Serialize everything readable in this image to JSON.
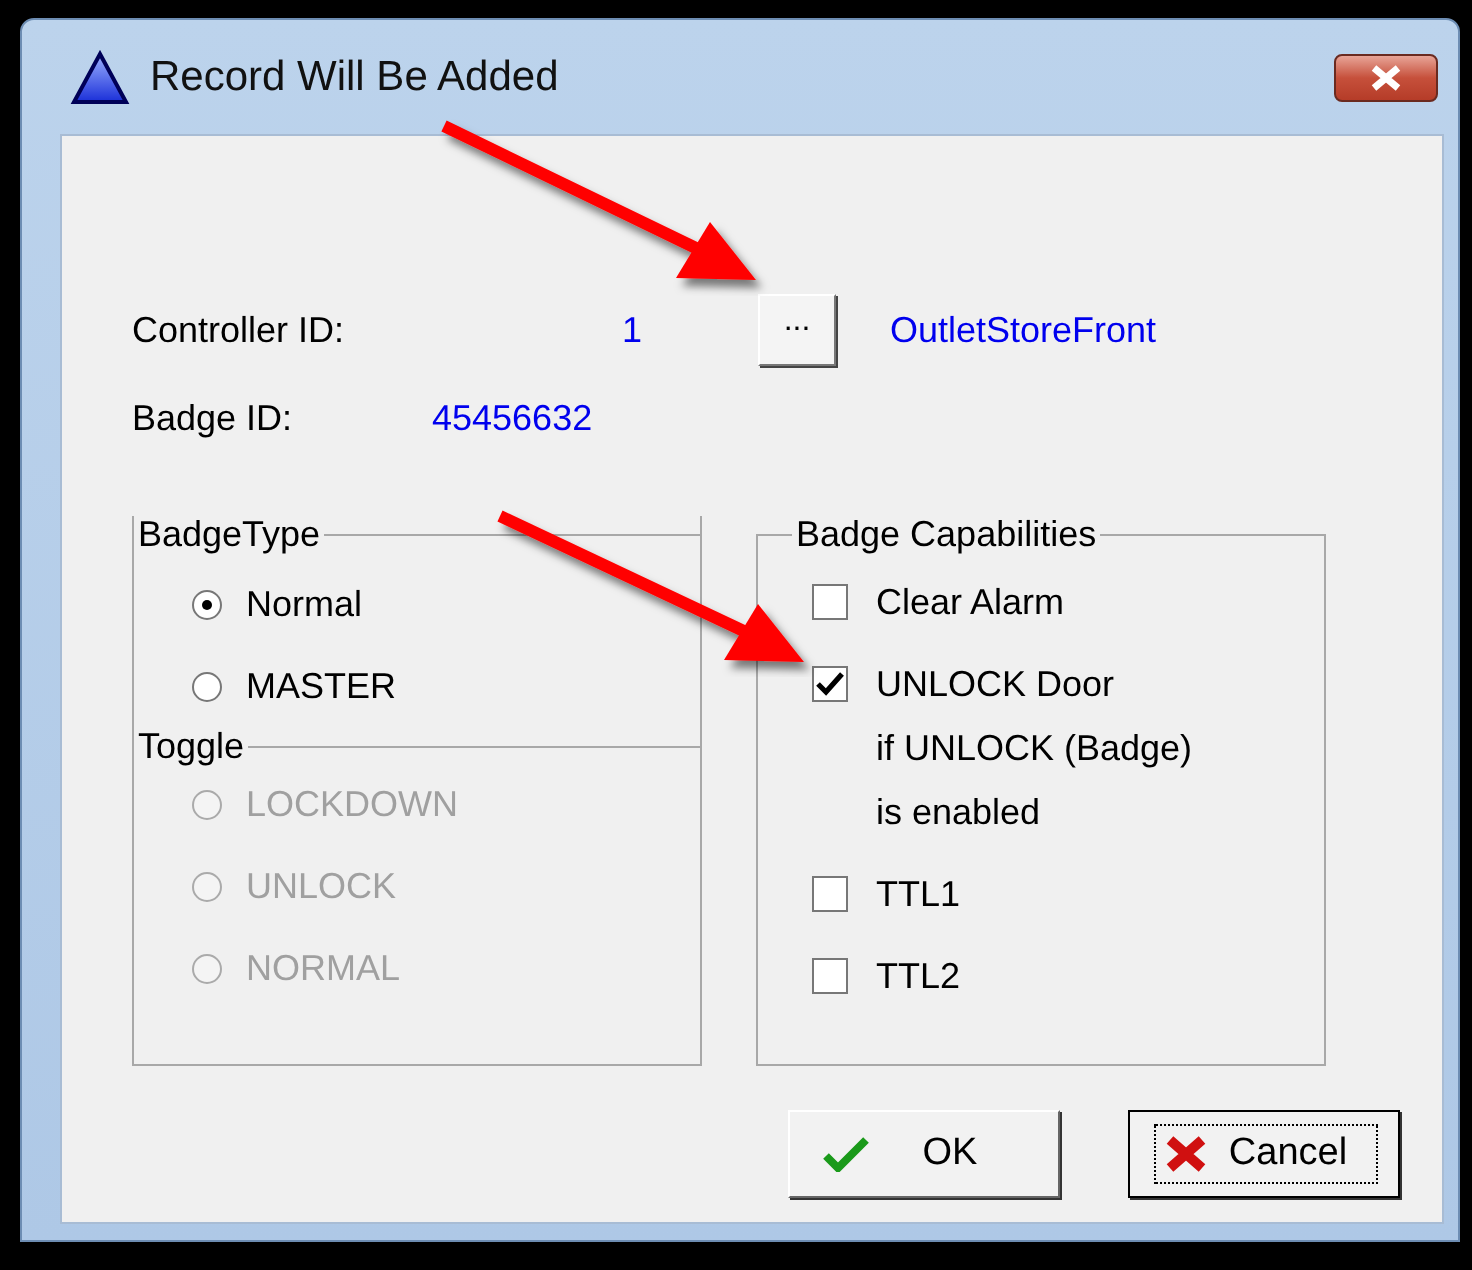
{
  "window": {
    "title": "Record Will Be Added"
  },
  "controller": {
    "label": "Controller ID:",
    "value": "1",
    "browse_button": "...",
    "name": "OutletStoreFront"
  },
  "badge": {
    "label": "Badge ID:",
    "value": "45456632"
  },
  "badge_type": {
    "title": "BadgeType",
    "options": [
      {
        "label": "Normal",
        "selected": true,
        "disabled": false
      },
      {
        "label": "MASTER",
        "selected": false,
        "disabled": false
      }
    ]
  },
  "toggle": {
    "title": "Toggle",
    "options": [
      {
        "label": "LOCKDOWN",
        "selected": false,
        "disabled": true
      },
      {
        "label": "UNLOCK",
        "selected": false,
        "disabled": true
      },
      {
        "label": "NORMAL",
        "selected": false,
        "disabled": true
      }
    ]
  },
  "capabilities": {
    "title": "Badge Capabilities",
    "items": [
      {
        "label": "Clear Alarm",
        "checked": false
      },
      {
        "label": "UNLOCK Door\nif UNLOCK (Badge)\nis enabled",
        "checked": true
      },
      {
        "label": "TTL1",
        "checked": false
      },
      {
        "label": "TTL2",
        "checked": false
      }
    ]
  },
  "buttons": [
    {
      "label": "OK",
      "kind": "ok",
      "focused": false
    },
    {
      "label": "Cancel",
      "kind": "cancel",
      "focused": true
    }
  ]
}
